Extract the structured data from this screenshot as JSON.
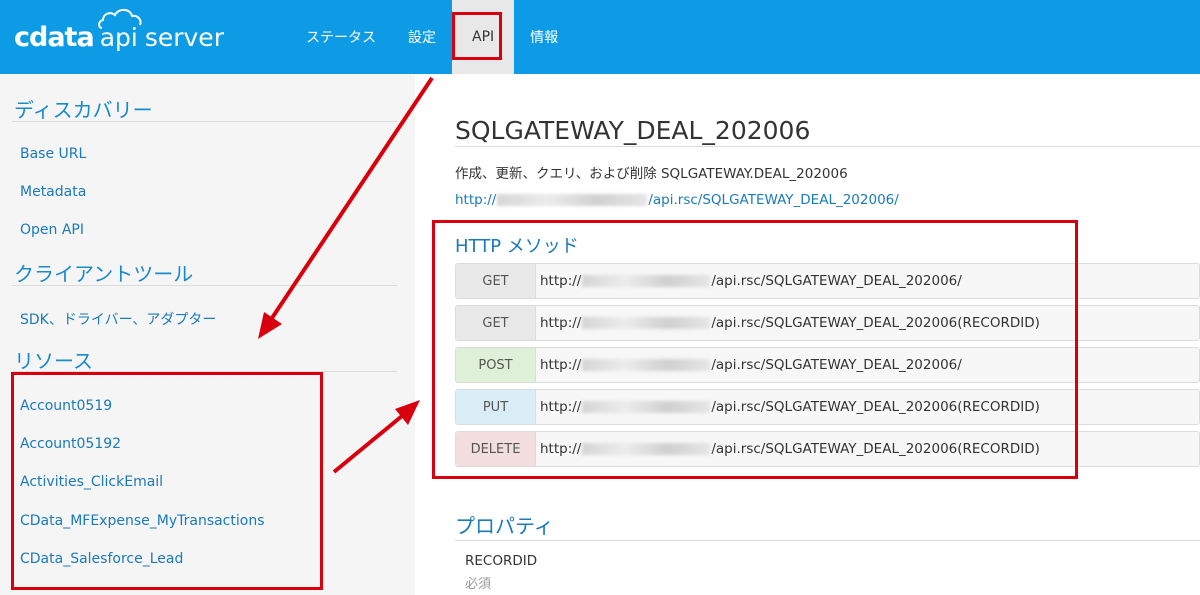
{
  "header": {
    "logo": {
      "brand": "cdata",
      "product_api": "api",
      "product_server": "server"
    },
    "nav": [
      "ステータス",
      "設定",
      "API",
      "情報"
    ],
    "active_nav": "API"
  },
  "sidebar": {
    "discovery_heading": "ディスカバリー",
    "discovery_links": [
      "Base URL",
      "Metadata",
      "Open API"
    ],
    "client_tools_heading": "クライアントツール",
    "client_tools_links": [
      "SDK、ドライバー、アダプター"
    ],
    "resources_heading": "リソース",
    "resources_links": [
      "Account0519",
      "Account05192",
      "Activities_ClickEmail",
      "CData_MFExpense_MyTransactions",
      "CData_Salesforce_Lead"
    ]
  },
  "main": {
    "title": "SQLGATEWAY_DEAL_202006",
    "description": "作成、更新、クエリ、および削除 SQLGATEWAY.DEAL_202006",
    "endpoint_prefix": "http://",
    "endpoint_suffix": "/api.rsc/SQLGATEWAY_DEAL_202006/",
    "http_methods_heading": "HTTP メソッド",
    "methods": [
      {
        "method": "GET",
        "url_prefix": "http://",
        "url_suffix": "/api.rsc/SQLGATEWAY_DEAL_202006/"
      },
      {
        "method": "GET",
        "url_prefix": "http://",
        "url_suffix": "/api.rsc/SQLGATEWAY_DEAL_202006(RECORDID)"
      },
      {
        "method": "POST",
        "url_prefix": "http://",
        "url_suffix": "/api.rsc/SQLGATEWAY_DEAL_202006/"
      },
      {
        "method": "PUT",
        "url_prefix": "http://",
        "url_suffix": "/api.rsc/SQLGATEWAY_DEAL_202006(RECORDID)"
      },
      {
        "method": "DELETE",
        "url_prefix": "http://",
        "url_suffix": "/api.rsc/SQLGATEWAY_DEAL_202006(RECORDID)"
      }
    ],
    "properties_heading": "プロパティ",
    "properties": [
      {
        "name": "RECORDID",
        "required_label": "必須"
      }
    ]
  },
  "colors": {
    "header_bg": "#0d9be6",
    "link": "#1b7ab8",
    "annotation_red": "#d9000d",
    "get_badge": "#e8e8e8",
    "post_badge": "#dff0d8",
    "put_badge": "#d9edf7",
    "delete_badge": "#f2dede"
  }
}
